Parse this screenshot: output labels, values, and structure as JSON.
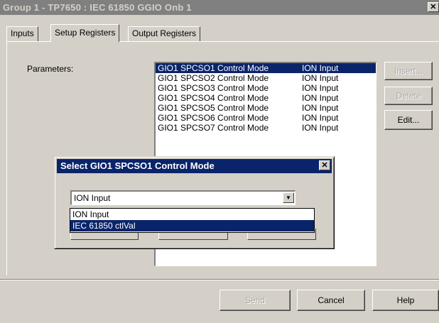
{
  "window": {
    "title": "Group 1 - TP7650 : IEC 61850 GGIO Onb 1",
    "close_label": "✕"
  },
  "tabs": [
    {
      "label": "Inputs"
    },
    {
      "label": "Setup Registers"
    },
    {
      "label": "Output Registers"
    }
  ],
  "parameters_label": "Parameters:",
  "registers": [
    {
      "name": "GIO1 SPCSO1 Control Mode",
      "value": "ION Input"
    },
    {
      "name": "GIO1 SPCSO2 Control Mode",
      "value": "ION Input"
    },
    {
      "name": "GIO1 SPCSO3 Control Mode",
      "value": "ION Input"
    },
    {
      "name": "GIO1 SPCSO4 Control Mode",
      "value": "ION Input"
    },
    {
      "name": "GIO1 SPCSO5 Control Mode",
      "value": "ION Input"
    },
    {
      "name": "GIO1 SPCSO6 Control Mode",
      "value": "ION Input"
    },
    {
      "name": "GIO1 SPCSO7 Control Mode",
      "value": "ION Input"
    }
  ],
  "side_buttons": {
    "insert": "Insert...",
    "delete": "Delete",
    "edit": "Edit..."
  },
  "footer_buttons": {
    "send": "Send",
    "cancel": "Cancel",
    "help": "Help"
  },
  "modal": {
    "title": "Select GIO1 SPCSO1 Control Mode",
    "close_label": "✕",
    "combo_value": "ION Input",
    "combo_arrow": "▼",
    "options": [
      "ION Input",
      "IEC 61850 ctlVal"
    ]
  },
  "colors": {
    "selection": "#0a246a",
    "face": "#d4d0c8",
    "inactive_title": "#808080"
  }
}
